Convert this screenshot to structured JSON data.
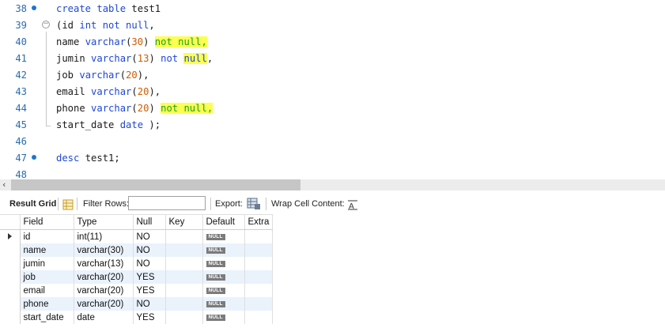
{
  "editor": {
    "lines": [
      {
        "num": "38",
        "tokens": [
          {
            "t": "create table ",
            "c": "kw"
          },
          {
            "t": "test1",
            "c": ""
          }
        ]
      },
      {
        "num": "39",
        "tokens": [
          {
            "t": "(id ",
            "c": ""
          },
          {
            "t": "int not null",
            "c": "kw"
          },
          {
            "t": ",",
            "c": ""
          }
        ]
      },
      {
        "num": "40",
        "tokens": [
          {
            "t": "name ",
            "c": ""
          },
          {
            "t": "varchar",
            "c": "kw"
          },
          {
            "t": "(",
            "c": ""
          },
          {
            "t": "30",
            "c": "num"
          },
          {
            "t": ") ",
            "c": ""
          },
          {
            "t": "not null,",
            "c": "hl nn"
          }
        ]
      },
      {
        "num": "41",
        "tokens": [
          {
            "t": "jumin ",
            "c": ""
          },
          {
            "t": "varchar",
            "c": "kw"
          },
          {
            "t": "(",
            "c": ""
          },
          {
            "t": "13",
            "c": "num"
          },
          {
            "t": ") ",
            "c": ""
          },
          {
            "t": "not ",
            "c": "kw"
          },
          {
            "t": "null",
            "c": "hl kw"
          },
          {
            "t": ",",
            "c": ""
          }
        ]
      },
      {
        "num": "42",
        "tokens": [
          {
            "t": "job ",
            "c": ""
          },
          {
            "t": "varchar",
            "c": "kw"
          },
          {
            "t": "(",
            "c": ""
          },
          {
            "t": "20",
            "c": "num"
          },
          {
            "t": "),",
            "c": ""
          }
        ]
      },
      {
        "num": "43",
        "tokens": [
          {
            "t": "email ",
            "c": ""
          },
          {
            "t": "varchar",
            "c": "kw"
          },
          {
            "t": "(",
            "c": ""
          },
          {
            "t": "20",
            "c": "num"
          },
          {
            "t": "),",
            "c": ""
          }
        ]
      },
      {
        "num": "44",
        "tokens": [
          {
            "t": "phone ",
            "c": ""
          },
          {
            "t": "varchar",
            "c": "kw"
          },
          {
            "t": "(",
            "c": ""
          },
          {
            "t": "20",
            "c": "num"
          },
          {
            "t": ") ",
            "c": ""
          },
          {
            "t": "not null,",
            "c": "hl nn"
          }
        ]
      },
      {
        "num": "45",
        "tokens": [
          {
            "t": "start_date ",
            "c": ""
          },
          {
            "t": "date",
            "c": "kw"
          },
          {
            "t": " );",
            "c": ""
          }
        ]
      },
      {
        "num": "46",
        "tokens": []
      },
      {
        "num": "47",
        "tokens": [
          {
            "t": "desc ",
            "c": "kw"
          },
          {
            "t": "test1;",
            "c": ""
          }
        ]
      },
      {
        "num": "48",
        "tokens": []
      }
    ],
    "markers": [
      "38",
      "47"
    ]
  },
  "toolbar": {
    "result_grid": "Result Grid",
    "filter_rows": "Filter Rows:",
    "filter_value": "",
    "export": "Export:",
    "wrap": "Wrap Cell Content:"
  },
  "grid": {
    "columns": [
      "Field",
      "Type",
      "Null",
      "Key",
      "Default",
      "Extra"
    ],
    "null_badge": "NULL",
    "rows": [
      {
        "field": "id",
        "type": "int(11)",
        "null": "NO",
        "key": "",
        "extra": ""
      },
      {
        "field": "name",
        "type": "varchar(30)",
        "null": "NO",
        "key": "",
        "extra": ""
      },
      {
        "field": "jumin",
        "type": "varchar(13)",
        "null": "NO",
        "key": "",
        "extra": ""
      },
      {
        "field": "job",
        "type": "varchar(20)",
        "null": "YES",
        "key": "",
        "extra": ""
      },
      {
        "field": "email",
        "type": "varchar(20)",
        "null": "YES",
        "key": "",
        "extra": ""
      },
      {
        "field": "phone",
        "type": "varchar(20)",
        "null": "NO",
        "key": "",
        "extra": ""
      },
      {
        "field": "start_date",
        "type": "date",
        "null": "YES",
        "key": "",
        "extra": ""
      }
    ]
  },
  "colors": {
    "keyword": "#1f47d6",
    "number": "#d35a00",
    "highlight": "#fbff4f",
    "alt_row": "#eaf2fc"
  }
}
